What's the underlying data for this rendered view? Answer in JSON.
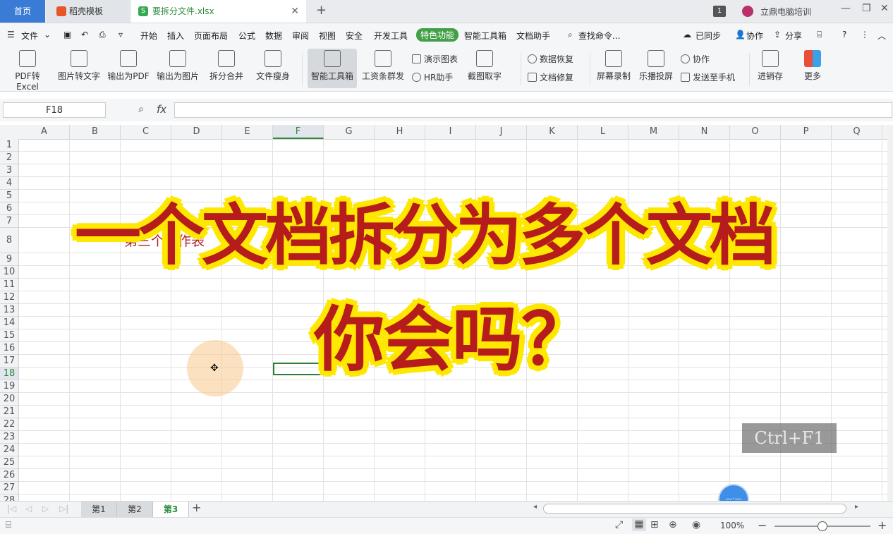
{
  "tabs": {
    "home": "首页",
    "template": "稻壳模板",
    "file": "要拆分文件.xlsx",
    "file_icon": "S",
    "page_badge": "1",
    "user": "立鼎电脑培训"
  },
  "menu": {
    "file": "文件",
    "items": [
      "开始",
      "插入",
      "页面布局",
      "公式",
      "数据",
      "审阅",
      "视图",
      "安全",
      "开发工具"
    ],
    "special": "特色功能",
    "after": [
      "智能工具箱",
      "文档助手"
    ],
    "search": "查找命令...",
    "sync": "已同步",
    "collab": "协作",
    "share": "分享"
  },
  "ribbon": {
    "buttons": [
      "PDF转Excel",
      "图片转文字",
      "输出为PDF",
      "输出为图片",
      "拆分合并",
      "文件瘦身",
      "智能工具箱",
      "工资条群发"
    ],
    "small1": [
      "演示图表",
      "HR助手"
    ],
    "crop": "截图取字",
    "small2": [
      "数据恢复",
      "文档修复"
    ],
    "buttons2": [
      "屏幕录制",
      "乐播投屏"
    ],
    "small3": [
      "协作",
      "发送至手机"
    ],
    "buttons3": [
      "进销存",
      "更多"
    ]
  },
  "formula": {
    "namebox": "F18",
    "fx": "fx",
    "value": ""
  },
  "grid": {
    "columns": [
      "A",
      "B",
      "C",
      "D",
      "E",
      "F",
      "G",
      "H",
      "I",
      "J",
      "K",
      "L",
      "M",
      "N",
      "O",
      "P",
      "Q"
    ],
    "selected_column": "F",
    "rows": [
      "1",
      "2",
      "3",
      "4",
      "5",
      "6",
      "7",
      "8",
      "9",
      "10",
      "11",
      "12",
      "13",
      "14",
      "15",
      "16",
      "17",
      "18",
      "19",
      "20",
      "21",
      "22",
      "23",
      "24",
      "25",
      "26",
      "27",
      "28"
    ],
    "selected_row": "18",
    "cell_text": "第三个工作表"
  },
  "overlay": {
    "line1": "一个文档拆分为多个文档",
    "line2": "你会吗？"
  },
  "shortcut": "Ctrl+F1",
  "sheets": [
    "第1",
    "第2",
    "第3"
  ],
  "active_sheet": "第3",
  "zoom": "100%"
}
